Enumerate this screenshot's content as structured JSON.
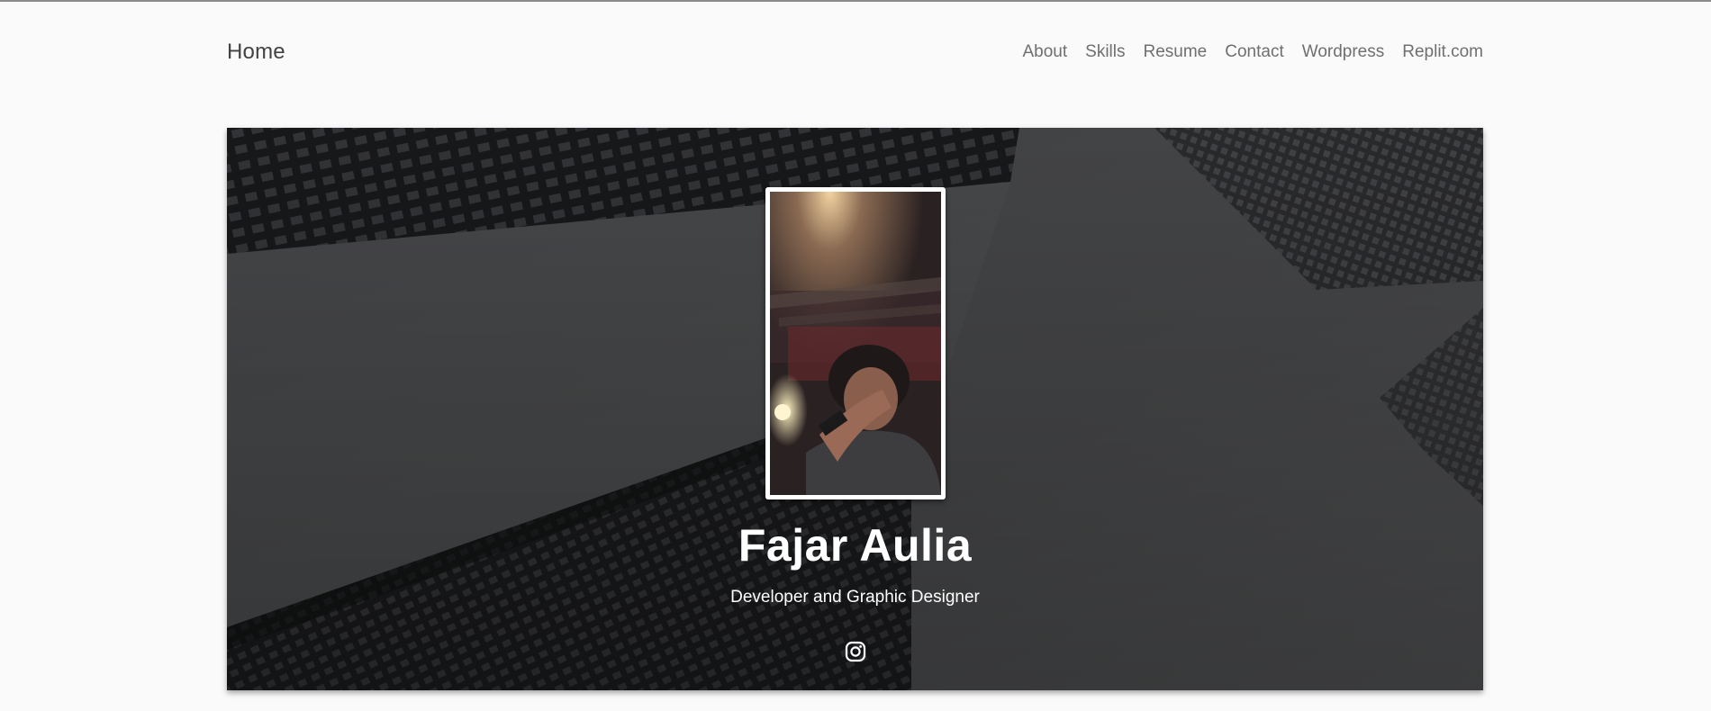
{
  "nav": {
    "brand": "Home",
    "links": [
      {
        "label": "About"
      },
      {
        "label": "Skills"
      },
      {
        "label": "Resume"
      },
      {
        "label": "Contact"
      },
      {
        "label": "Wordpress"
      },
      {
        "label": "Replit.com"
      }
    ]
  },
  "hero": {
    "name": "Fajar Aulia",
    "subtitle": "Developer and Graphic Designer",
    "social_icon": "instagram-icon"
  },
  "colors": {
    "page_bg": "#fafafa",
    "nav_text": "#6f6f6f",
    "brand_text": "#424242",
    "hero_text": "#ffffff"
  }
}
